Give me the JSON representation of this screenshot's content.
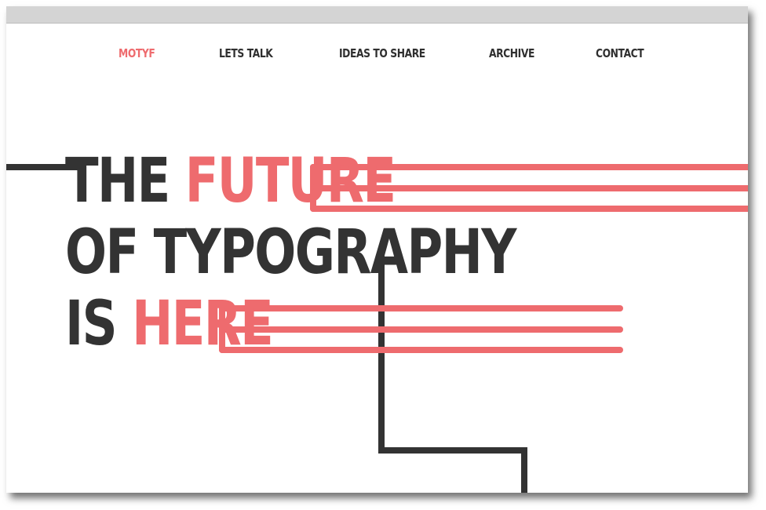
{
  "nav": {
    "items": [
      {
        "label": "MOTYF",
        "active": true
      },
      {
        "label": "LETS TALK",
        "active": false
      },
      {
        "label": "IDEAS TO SHARE",
        "active": false
      },
      {
        "label": "ARCHIVE",
        "active": false
      },
      {
        "label": "CONTACT",
        "active": false
      }
    ]
  },
  "hero": {
    "line1_a": "THE ",
    "line1_b": "FUTURE",
    "line2": "OF TYPOGRAPHY",
    "line3_a": "IS ",
    "line3_b": "HERE"
  },
  "colors": {
    "accent": "#ee6b6e",
    "text": "#333333",
    "browser_bar": "#d4d4d4"
  }
}
